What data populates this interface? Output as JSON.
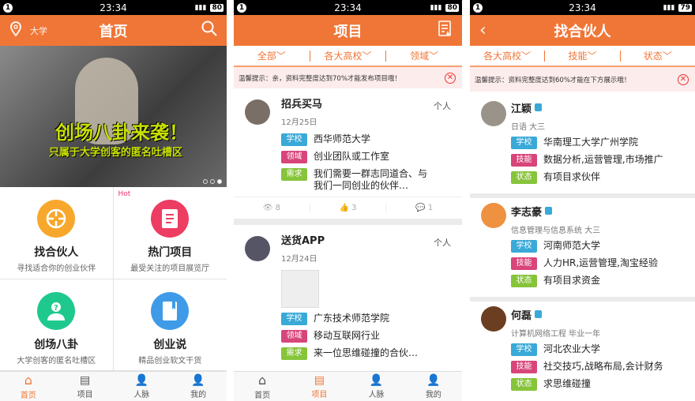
{
  "status": {
    "time": "23:34",
    "notif": "1",
    "battery1": "80",
    "battery2": "80",
    "battery3": "79"
  },
  "colors": {
    "accent": "#f07637",
    "school": "#39a9d8",
    "field": "#d8457a",
    "need": "#86c43a"
  },
  "home": {
    "title": "首页",
    "location": "大学",
    "banner_title": "创场八卦来袭！",
    "banner_sub": "只属于大学创客的匿名吐槽区",
    "hot": "Hot",
    "tiles": [
      {
        "title": "找合伙人",
        "sub": "寻找适合你的创业伙伴",
        "icon": "crosshair-icon",
        "color": "#f7a82c"
      },
      {
        "title": "热门项目",
        "sub": "最受关注的项目展览厅",
        "icon": "document-icon",
        "color": "#ee3d62"
      },
      {
        "title": "创场八卦",
        "sub": "大学创客的匿名吐槽区",
        "icon": "anonymous-user-icon",
        "color": "#1fc98e"
      },
      {
        "title": "创业说",
        "sub": "精品创业软文干货",
        "icon": "book-icon",
        "color": "#3f9be8"
      }
    ]
  },
  "nav": [
    "首页",
    "项目",
    "人脉",
    "我的"
  ],
  "projects": {
    "title": "项目",
    "filters": [
      "全部",
      "各大高校",
      "领域"
    ],
    "notice": "温馨提示：亲，资料完整度达到70%才能发布项目哦！",
    "labels": {
      "school": "学校",
      "field": "领域",
      "need": "需求"
    },
    "items": [
      {
        "name": "招兵买马",
        "kind": "个人",
        "date": "12月25日",
        "school": "西华师范大学",
        "field": "创业团队或工作室",
        "need": "我们需要一群志同道合、与我们一同创业的伙伴…",
        "views": "8",
        "likes": "3",
        "comments": "1"
      },
      {
        "name": "送货APP",
        "kind": "个人",
        "date": "12月24日",
        "school": "广东技术师范学院",
        "field": "移动互联网行业",
        "need": "来一位思维碰撞的合伙…"
      }
    ]
  },
  "partners": {
    "title": "找合伙人",
    "filters": [
      "各大高校",
      "技能",
      "状态"
    ],
    "notice": "温馨提示：资料完整度达到60%才能在下方展示哦！",
    "labels": {
      "school": "学校",
      "skill": "技能",
      "state": "状态"
    },
    "items": [
      {
        "name": "江颖",
        "sub": "日语 大三",
        "school": "华南理工大学广州学院",
        "skill": "数据分析,运营管理,市场推广",
        "state": "有项目求伙伴"
      },
      {
        "name": "李志豪",
        "sub": "信息管理与信息系统 大三",
        "school": "河南师范大学",
        "skill": "人力HR,运营管理,淘宝经验",
        "state": "有项目求资金"
      },
      {
        "name": "何磊",
        "sub": "计算机网络工程 毕业一年",
        "school": "河北农业大学",
        "skill": "社交技巧,战略布局,会计财务",
        "state": "求思维碰撞"
      }
    ]
  }
}
